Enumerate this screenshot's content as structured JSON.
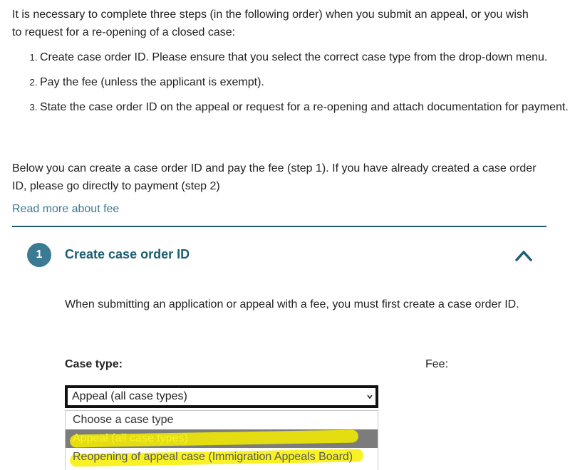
{
  "intro_text": "It is necessary to complete three steps (in the following order) when you submit an appeal, or you wish to request for a re-opening of a closed case:",
  "steps": [
    "Create case order ID. Please ensure that you select the correct case type from the drop-down menu.",
    "Pay the fee (unless the applicant is exempt).",
    "State the case order ID on the appeal or request for a re-opening and attach documentation for payment."
  ],
  "below_text": "Below you can create a case order ID and pay the fee (step 1). If you have already created a case order ID, please go directly to payment (step 2)",
  "read_more_link": "Read more about fee",
  "step1": {
    "number": "1",
    "title": "Create case order ID",
    "description": "When submitting an application or appeal with a fee, you must first create a case order ID.",
    "case_type_label": "Case type:",
    "fee_label": "Fee:",
    "selected_value": "Appeal (all case types)",
    "options": [
      "Choose a case type",
      "Appeal (all case types)",
      "Reopening of appeal case (Immigration Appeals Board)"
    ]
  },
  "colors": {
    "accent": "#1d5d72",
    "link": "#3b7a93",
    "highlight": "#f6ef00"
  },
  "icons": {
    "collapse": "chevron-up-icon",
    "select": "chevron-down-icon"
  }
}
